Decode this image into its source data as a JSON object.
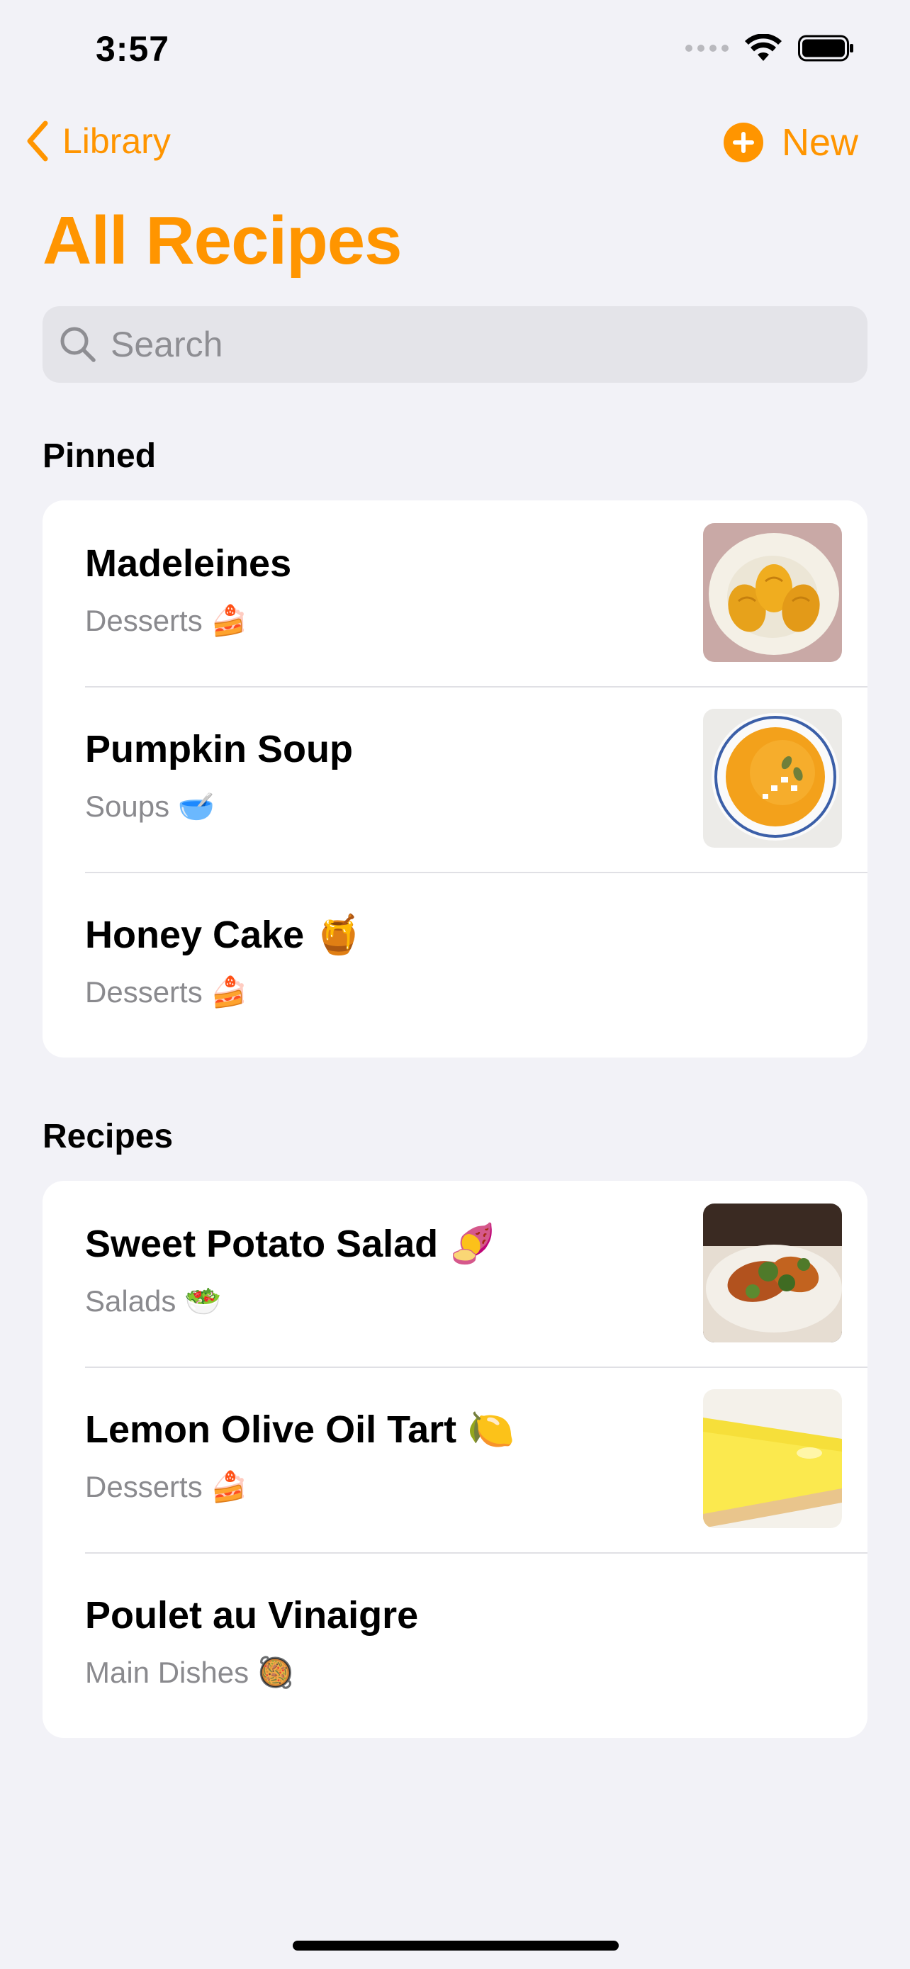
{
  "status_bar": {
    "time": "3:57"
  },
  "nav": {
    "back_label": "Library",
    "new_label": "New",
    "accent": "#ff9500"
  },
  "title": "All Recipes",
  "search": {
    "placeholder": "Search",
    "value": ""
  },
  "sections": [
    {
      "header": "Pinned",
      "rows": [
        {
          "title": "Madeleines",
          "subtitle": "Desserts 🍰",
          "thumbnail": "madeleines-photo"
        },
        {
          "title": "Pumpkin Soup",
          "subtitle": "Soups 🥣",
          "thumbnail": "pumpkin-soup-photo"
        },
        {
          "title": "Honey Cake 🍯",
          "subtitle": "Desserts 🍰"
        }
      ]
    },
    {
      "header": "Recipes",
      "rows": [
        {
          "title": "Sweet Potato Salad 🍠",
          "subtitle": "Salads 🥗",
          "thumbnail": "sweet-potato-salad-photo"
        },
        {
          "title": "Lemon Olive Oil Tart 🍋",
          "subtitle": "Desserts 🍰",
          "thumbnail": "lemon-tart-photo"
        },
        {
          "title": "Poulet au Vinaigre",
          "subtitle": "Main Dishes 🥘"
        }
      ]
    }
  ]
}
